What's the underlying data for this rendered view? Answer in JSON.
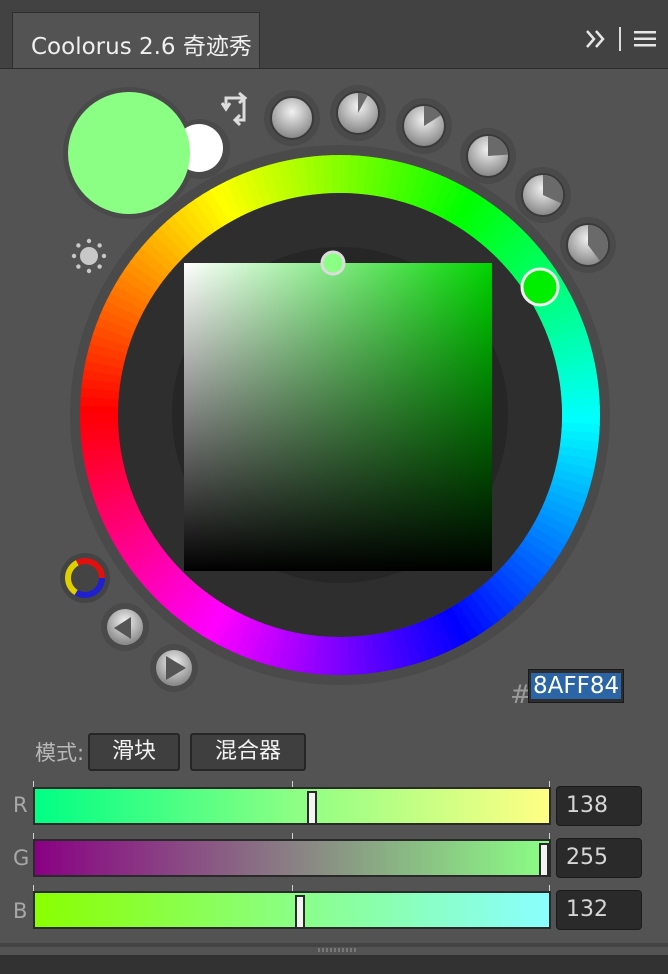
{
  "panel": {
    "title": "Coolorus 2.6 奇迹秀"
  },
  "header_icons": {
    "collapse": "double-chevron-right-icon",
    "menu": "hamburger-menu-icon"
  },
  "color": {
    "foreground": "#8AFF84",
    "background": "#FFFFFF",
    "hue_thumb": "#00EE00",
    "hex_hash": "#",
    "hex": "8AFF84"
  },
  "wheel_tools": {
    "swap": "swap-arrows-icon",
    "brightness": "sun-icon",
    "gamut": "color-gamut-icon",
    "triangle": "triangle-mode-icon",
    "play": "play-icon",
    "presets": [
      "preset-dial-1-icon",
      "preset-dial-2-icon",
      "preset-dial-3-icon",
      "preset-dial-4-icon",
      "preset-dial-5-icon",
      "preset-dial-6-icon"
    ]
  },
  "mode": {
    "label": "模式:",
    "slider_label": "滑块",
    "mixer_label": "混合器"
  },
  "channels": [
    {
      "label": "R",
      "value": "138",
      "fraction": 0.541
    },
    {
      "label": "G",
      "value": "255",
      "fraction": 1.0
    },
    {
      "label": "B",
      "value": "132",
      "fraction": 0.518
    }
  ]
}
